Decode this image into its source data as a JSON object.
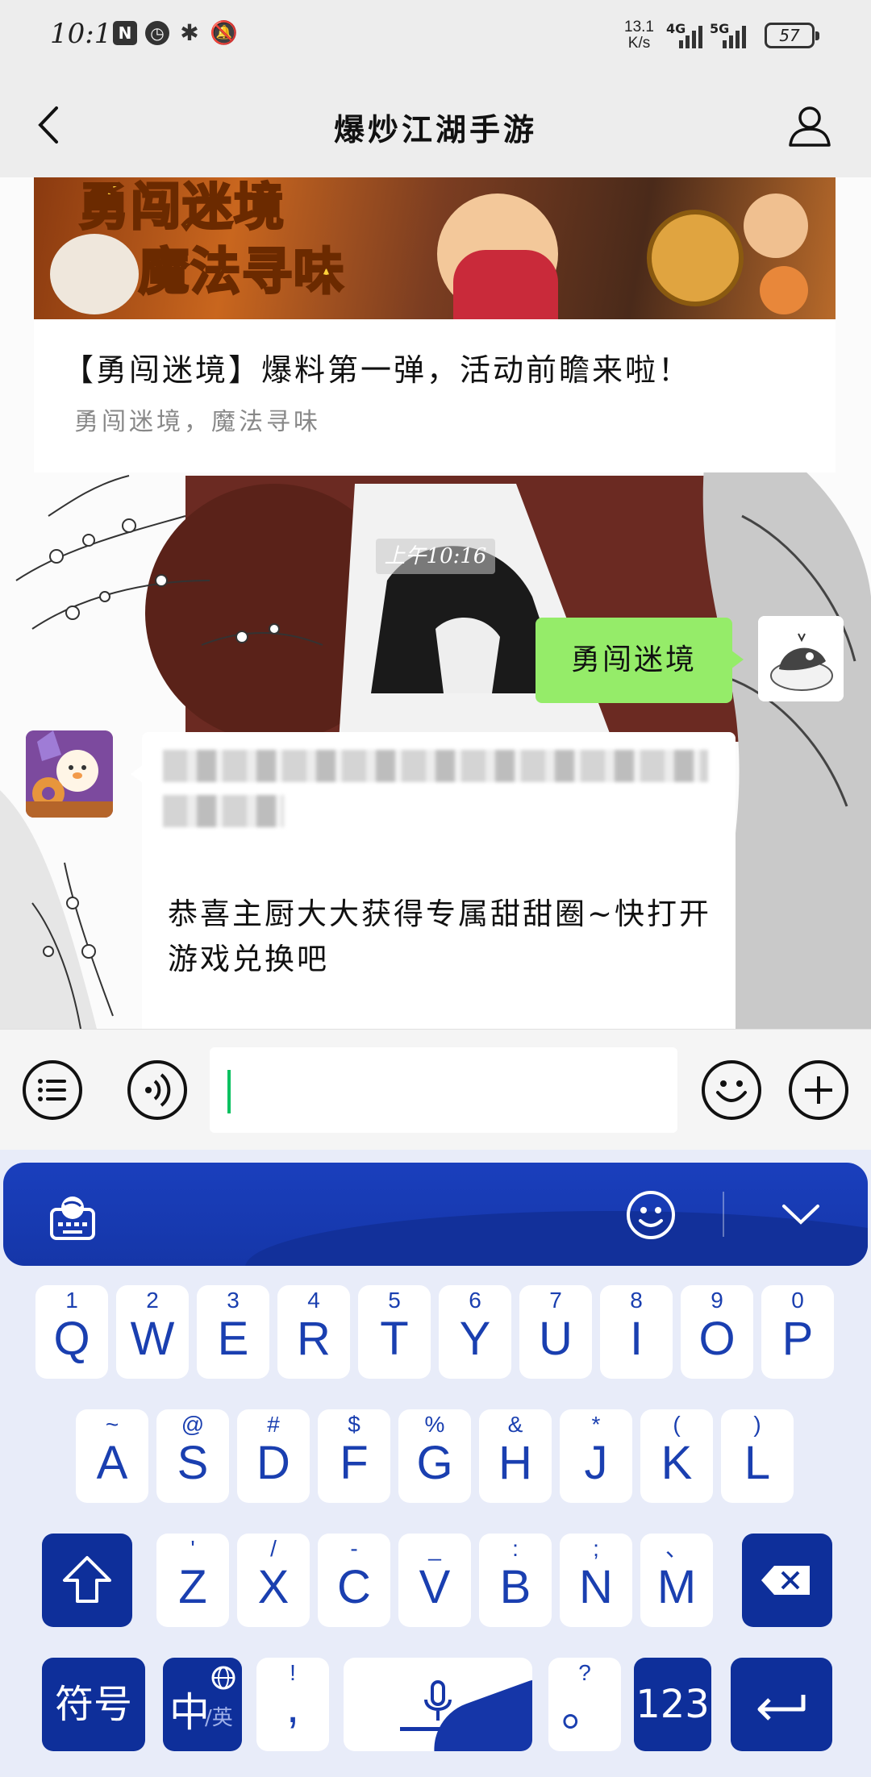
{
  "status_bar": {
    "time": "10:16",
    "net_speed_value": "13.1",
    "net_speed_unit": "K/s",
    "sig1_label": "4G",
    "sig2_label": "5G",
    "battery": "57"
  },
  "header": {
    "title": "爆炒江湖手游"
  },
  "chat": {
    "article": {
      "banner_line1": "勇闯迷境",
      "banner_line2": "魔法寻味",
      "title": "【勇闯迷境】爆料第一弹，活动前瞻来啦！",
      "subtitle": "勇闯迷境，魔法寻味"
    },
    "timestamp": "上午10:16",
    "sent_message": "勇闯迷境",
    "received_message": "恭喜主厨大大获得专属甜甜圈~快打开游戏兑换吧"
  },
  "keyboard": {
    "row1": [
      {
        "num": "1",
        "ch": "Q"
      },
      {
        "num": "2",
        "ch": "W"
      },
      {
        "num": "3",
        "ch": "E"
      },
      {
        "num": "4",
        "ch": "R"
      },
      {
        "num": "5",
        "ch": "T"
      },
      {
        "num": "6",
        "ch": "Y"
      },
      {
        "num": "7",
        "ch": "U"
      },
      {
        "num": "8",
        "ch": "I"
      },
      {
        "num": "9",
        "ch": "O"
      },
      {
        "num": "0",
        "ch": "P"
      }
    ],
    "row2": [
      {
        "num": "~",
        "ch": "A"
      },
      {
        "num": "@",
        "ch": "S"
      },
      {
        "num": "#",
        "ch": "D"
      },
      {
        "num": "$",
        "ch": "F"
      },
      {
        "num": "%",
        "ch": "G"
      },
      {
        "num": "&",
        "ch": "H"
      },
      {
        "num": "*",
        "ch": "J"
      },
      {
        "num": "(",
        "ch": "K"
      },
      {
        "num": ")",
        "ch": "L"
      }
    ],
    "row3": [
      {
        "num": "'",
        "ch": "Z"
      },
      {
        "num": "/",
        "ch": "X"
      },
      {
        "num": "-",
        "ch": "C"
      },
      {
        "num": "_",
        "ch": "V"
      },
      {
        "num": ":",
        "ch": "B"
      },
      {
        "num": ";",
        "ch": "N"
      },
      {
        "num": "、",
        "ch": "M"
      }
    ],
    "symbols_label": "符号",
    "lang_main": "中",
    "lang_alt": "/英",
    "comma_top": "!",
    "comma_main": ",",
    "period_top": "?",
    "period_main": "。",
    "numbers_label": "123"
  },
  "colors": {
    "accent_blue": "#1536a8",
    "bubble_green": "#95ec69",
    "caret_green": "#07c160"
  }
}
